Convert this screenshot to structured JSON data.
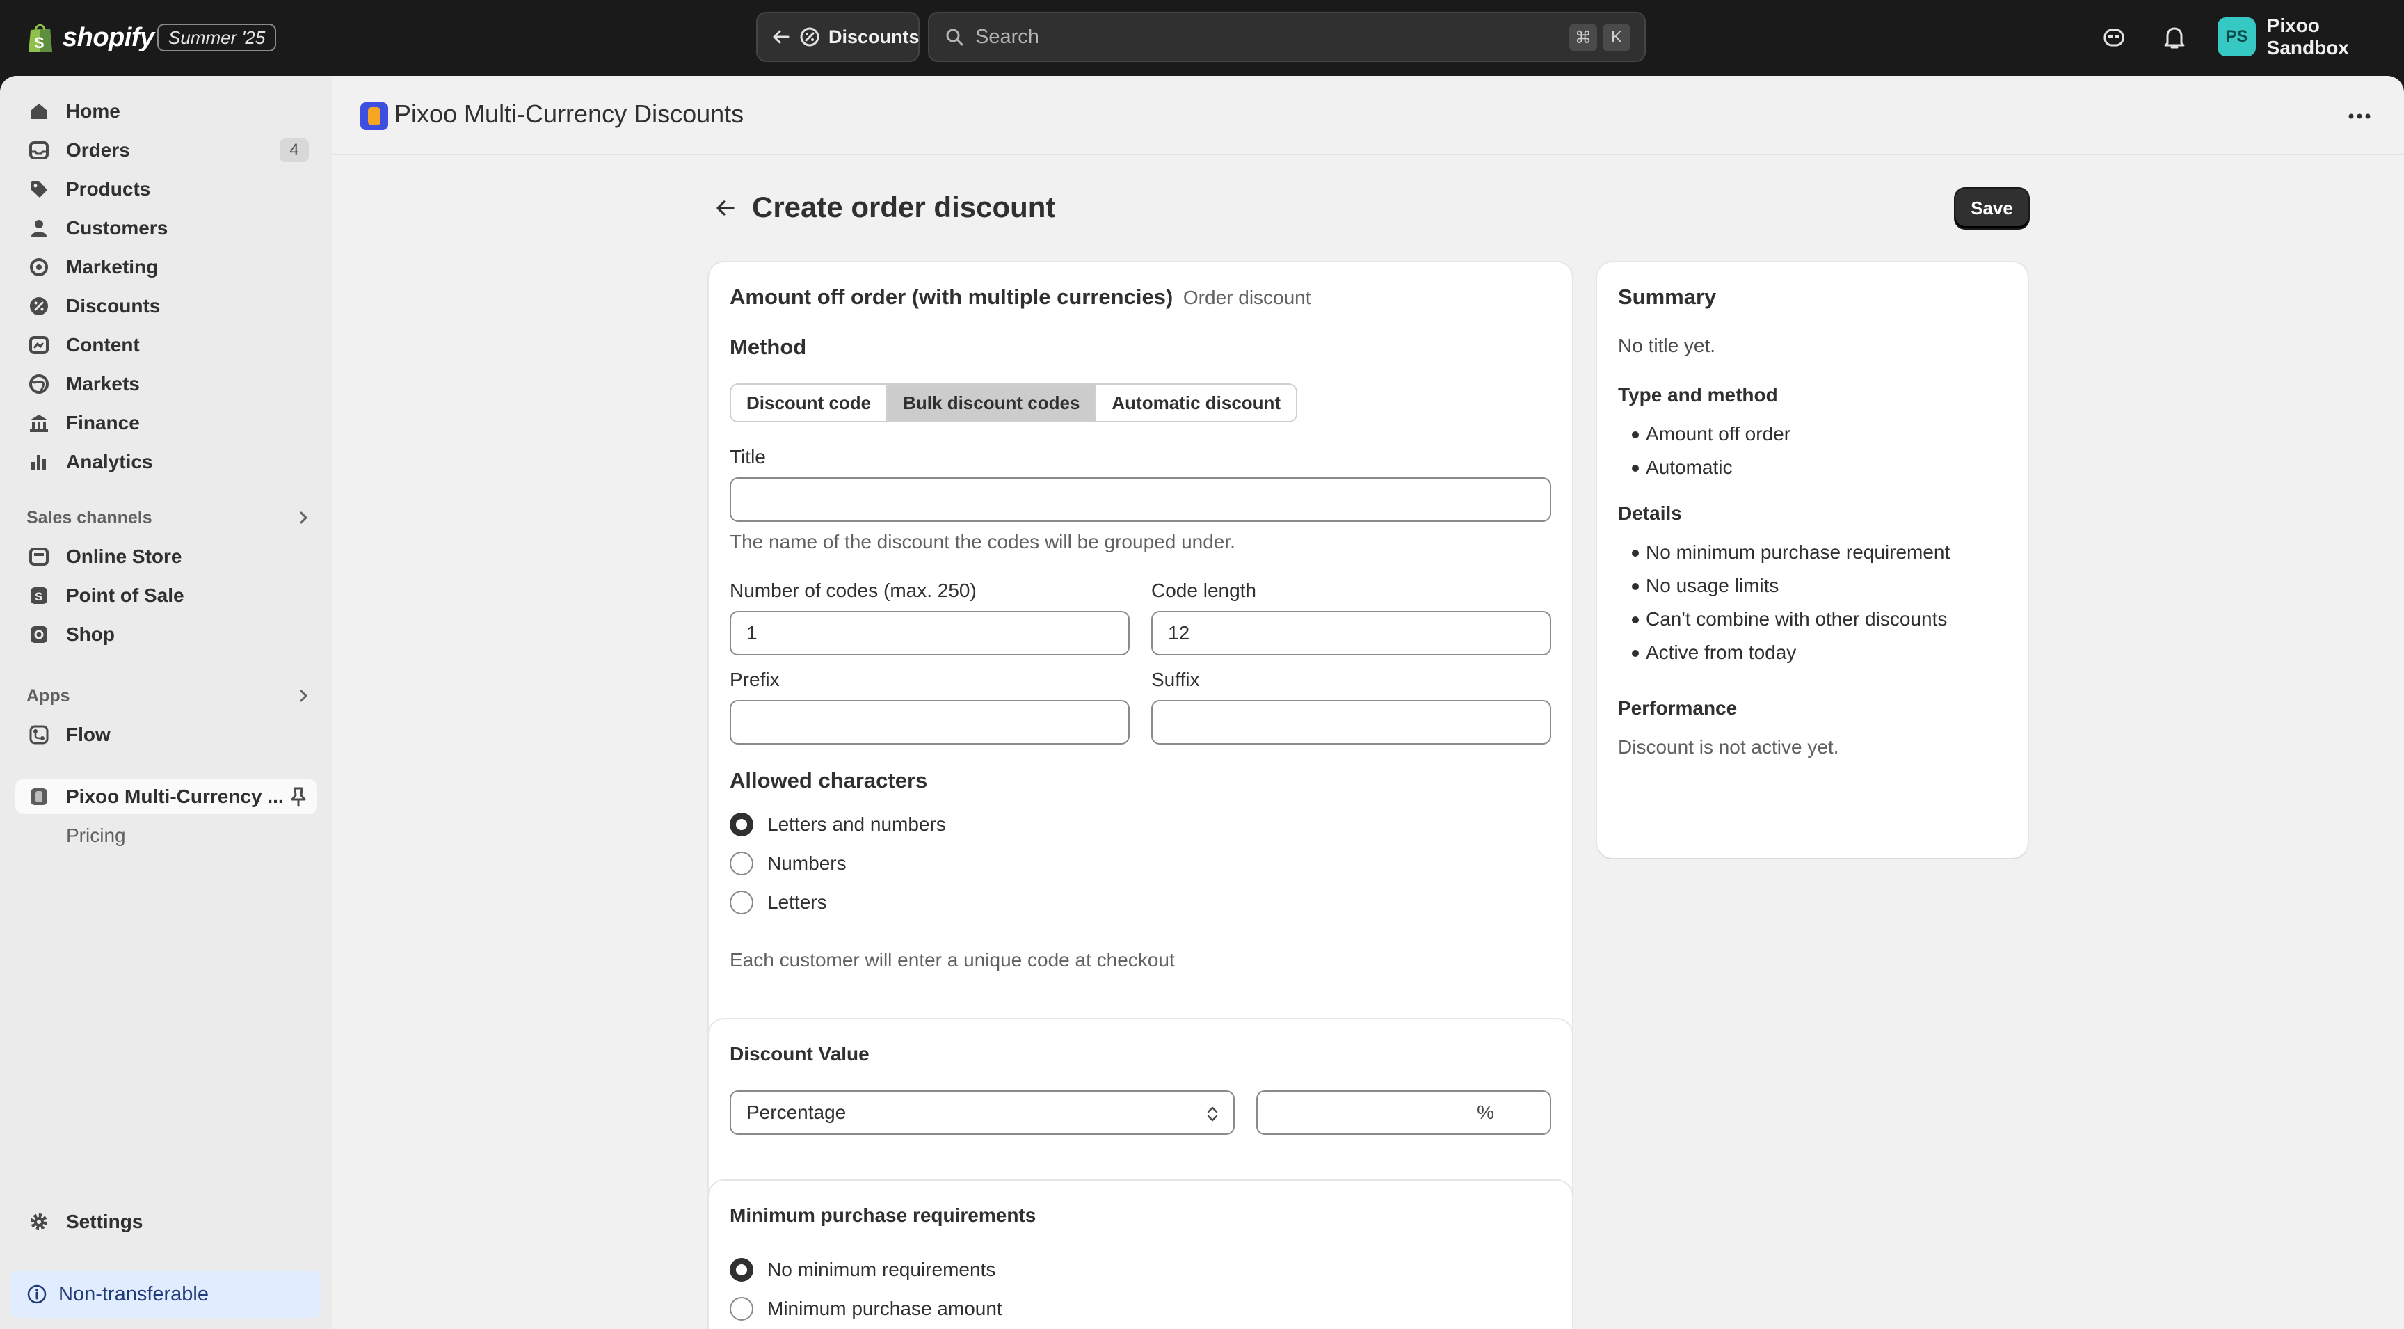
{
  "topbar": {
    "logo_text": "shopify",
    "edition_badge": "Summer '25",
    "breadcrumb_label": "Discounts",
    "search_placeholder": "Search",
    "search_shortcut_1": "⌘",
    "search_shortcut_2": "K",
    "account_initials": "PS",
    "account_name": "Pixoo Sandbox"
  },
  "sidebar": {
    "items": [
      {
        "label": "Home",
        "icon": "home-icon"
      },
      {
        "label": "Orders",
        "icon": "orders-icon",
        "badge": "4"
      },
      {
        "label": "Products",
        "icon": "tag-icon"
      },
      {
        "label": "Customers",
        "icon": "person-icon"
      },
      {
        "label": "Marketing",
        "icon": "target-icon"
      },
      {
        "label": "Discounts",
        "icon": "discount-icon"
      },
      {
        "label": "Content",
        "icon": "content-icon"
      },
      {
        "label": "Markets",
        "icon": "globe-icon"
      },
      {
        "label": "Finance",
        "icon": "bank-icon"
      },
      {
        "label": "Analytics",
        "icon": "chart-icon"
      }
    ],
    "sales_channels_label": "Sales channels",
    "sales_channels": [
      {
        "label": "Online Store",
        "icon": "store-icon"
      },
      {
        "label": "Point of Sale",
        "icon": "pos-icon"
      },
      {
        "label": "Shop",
        "icon": "shop-icon"
      }
    ],
    "apps_label": "Apps",
    "apps": [
      {
        "label": "Flow",
        "icon": "flow-icon"
      }
    ],
    "pinned_app": "Pixoo Multi-Currency ...",
    "pinned_app_sub": "Pricing",
    "settings_label": "Settings",
    "non_transferable": "Non-transferable"
  },
  "app_header": {
    "title": "Pixoo Multi-Currency Discounts"
  },
  "page": {
    "title": "Create order discount",
    "save_label": "Save"
  },
  "main_card": {
    "heading": "Amount off order (with multiple currencies)",
    "heading_sub": "Order discount",
    "method_label": "Method",
    "method_options": [
      "Discount code",
      "Bulk discount codes",
      "Automatic discount"
    ],
    "method_selected": "Bulk discount codes",
    "title_label": "Title",
    "title_value": "",
    "title_help": "The name of the discount the codes will be grouped under.",
    "num_codes_label": "Number of codes (max. 250)",
    "num_codes_value": "1",
    "code_length_label": "Code length",
    "code_length_value": "12",
    "prefix_label": "Prefix",
    "prefix_value": "",
    "suffix_label": "Suffix",
    "suffix_value": "",
    "allowed_chars_label": "Allowed characters",
    "allowed_chars_options": [
      "Letters and numbers",
      "Numbers",
      "Letters"
    ],
    "allowed_chars_selected": "Letters and numbers",
    "footer_help": "Each customer will enter a unique code at checkout"
  },
  "discount_value": {
    "heading": "Discount Value",
    "type_value": "Percentage",
    "amount_value": "",
    "amount_suffix": "%"
  },
  "min_purchase": {
    "heading": "Minimum purchase requirements",
    "options": [
      "No minimum requirements",
      "Minimum purchase amount"
    ],
    "selected": "No minimum requirements"
  },
  "summary": {
    "heading": "Summary",
    "no_title": "No title yet.",
    "type_method_label": "Type and method",
    "type_method_items": [
      "Amount off order",
      "Automatic"
    ],
    "details_label": "Details",
    "details_items": [
      "No minimum purchase requirement",
      "No usage limits",
      "Can't combine with other discounts",
      "Active from today"
    ],
    "performance_label": "Performance",
    "performance_text": "Discount is not active yet."
  }
}
